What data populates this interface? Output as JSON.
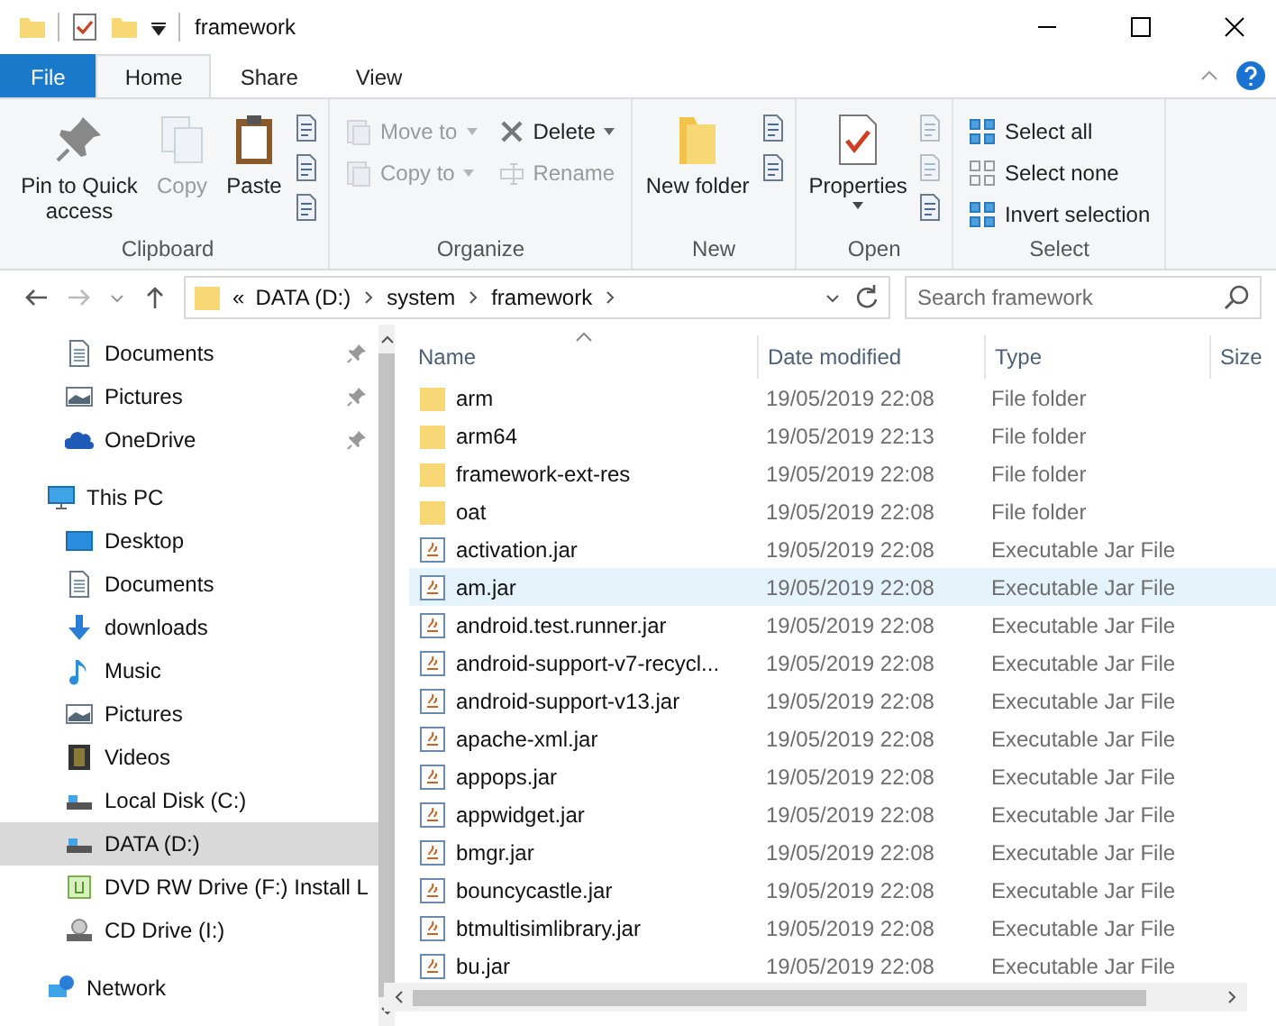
{
  "window": {
    "title": "framework"
  },
  "ribbon_tabs": [
    {
      "label": "File",
      "kind": "file",
      "selected": false
    },
    {
      "label": "Home",
      "kind": "tab",
      "selected": true
    },
    {
      "label": "Share",
      "kind": "tab",
      "selected": false
    },
    {
      "label": "View",
      "kind": "tab",
      "selected": false
    }
  ],
  "ribbon_groups": [
    {
      "label": "Clipboard",
      "columns": [
        [
          {
            "label": "Pin to Quick access",
            "kind": "large",
            "disabled": false,
            "dropdown": false
          }
        ],
        [
          {
            "label": "Copy",
            "kind": "large",
            "disabled": true,
            "dropdown": false
          }
        ],
        [
          {
            "label": "Paste",
            "kind": "large",
            "disabled": false,
            "dropdown": false
          }
        ],
        [
          {
            "kind": "icon",
            "disabled": false
          },
          {
            "kind": "icon",
            "disabled": false
          },
          {
            "kind": "icon",
            "disabled": false
          }
        ]
      ]
    },
    {
      "label": "Organize",
      "columns": [
        [
          {
            "label": "Move to",
            "kind": "small",
            "disabled": true,
            "dropdown": true
          },
          {
            "label": "Copy to",
            "kind": "small",
            "disabled": true,
            "dropdown": true
          }
        ],
        [
          {
            "label": "Delete",
            "kind": "small",
            "disabled": false,
            "dropdown": true
          },
          {
            "label": "Rename",
            "kind": "small",
            "disabled": true,
            "dropdown": false
          }
        ]
      ]
    },
    {
      "label": "New",
      "columns": [
        [
          {
            "label": "New folder",
            "kind": "large",
            "disabled": false,
            "dropdown": false
          }
        ],
        [
          {
            "kind": "icon",
            "disabled": false
          },
          {
            "kind": "icon",
            "disabled": false
          }
        ]
      ]
    },
    {
      "label": "Open",
      "columns": [
        [
          {
            "label": "Properties",
            "kind": "large",
            "disabled": false,
            "dropdown": true
          }
        ],
        [
          {
            "kind": "icon",
            "disabled": true
          },
          {
            "kind": "icon",
            "disabled": true
          },
          {
            "kind": "icon",
            "disabled": false
          }
        ]
      ]
    },
    {
      "label": "Select",
      "columns": [
        [
          {
            "label": "Select all",
            "kind": "small",
            "disabled": false,
            "dropdown": false
          },
          {
            "label": "Select none",
            "kind": "small",
            "disabled": false,
            "dropdown": false
          },
          {
            "label": "Invert selection",
            "kind": "small",
            "disabled": false,
            "dropdown": false
          }
        ]
      ]
    }
  ],
  "address": {
    "overflow": "«",
    "segments": [
      "DATA (D:)",
      "system",
      "framework"
    ]
  },
  "search": {
    "placeholder": "Search framework"
  },
  "nav": [
    {
      "label": "Documents",
      "pinned": true,
      "selected": false
    },
    {
      "label": "Pictures",
      "pinned": true,
      "selected": false
    },
    {
      "label": "OneDrive",
      "pinned": true,
      "selected": false
    },
    {
      "label": "This PC",
      "pinned": false,
      "selected": false,
      "children": [
        {
          "label": "Desktop",
          "pinned": false,
          "selected": false
        },
        {
          "label": "Documents",
          "pinned": false,
          "selected": false
        },
        {
          "label": "downloads",
          "pinned": false,
          "selected": false
        },
        {
          "label": "Music",
          "pinned": false,
          "selected": false
        },
        {
          "label": "Pictures",
          "pinned": false,
          "selected": false
        },
        {
          "label": "Videos",
          "pinned": false,
          "selected": false
        },
        {
          "label": "Local Disk (C:)",
          "pinned": false,
          "selected": false
        },
        {
          "label": "DATA (D:)",
          "pinned": false,
          "selected": true
        },
        {
          "label": "DVD RW Drive (F:) Install L",
          "pinned": false,
          "selected": false
        },
        {
          "label": "CD Drive (I:)",
          "pinned": false,
          "selected": false
        }
      ]
    },
    {
      "label": "Network",
      "pinned": false,
      "selected": false
    }
  ],
  "table": {
    "columns": [
      {
        "label": "Name",
        "sorted": true
      },
      {
        "label": "Date modified",
        "sorted": false
      },
      {
        "label": "Type",
        "sorted": false
      },
      {
        "label": "Size",
        "sorted": false
      }
    ],
    "rows": [
      {
        "kind": "folder",
        "name": "arm",
        "date": "19/05/2019 22:08",
        "type": "File folder",
        "selected": false
      },
      {
        "kind": "folder",
        "name": "arm64",
        "date": "19/05/2019 22:13",
        "type": "File folder",
        "selected": false
      },
      {
        "kind": "folder",
        "name": "framework-ext-res",
        "date": "19/05/2019 22:08",
        "type": "File folder",
        "selected": false
      },
      {
        "kind": "folder",
        "name": "oat",
        "date": "19/05/2019 22:08",
        "type": "File folder",
        "selected": false
      },
      {
        "kind": "jar",
        "name": "activation.jar",
        "date": "19/05/2019 22:08",
        "type": "Executable Jar File",
        "selected": false
      },
      {
        "kind": "jar",
        "name": "am.jar",
        "date": "19/05/2019 22:08",
        "type": "Executable Jar File",
        "selected": true
      },
      {
        "kind": "jar",
        "name": "android.test.runner.jar",
        "date": "19/05/2019 22:08",
        "type": "Executable Jar File",
        "selected": false
      },
      {
        "kind": "jar",
        "name": "android-support-v7-recycl...",
        "date": "19/05/2019 22:08",
        "type": "Executable Jar File",
        "selected": false
      },
      {
        "kind": "jar",
        "name": "android-support-v13.jar",
        "date": "19/05/2019 22:08",
        "type": "Executable Jar File",
        "selected": false
      },
      {
        "kind": "jar",
        "name": "apache-xml.jar",
        "date": "19/05/2019 22:08",
        "type": "Executable Jar File",
        "selected": false
      },
      {
        "kind": "jar",
        "name": "appops.jar",
        "date": "19/05/2019 22:08",
        "type": "Executable Jar File",
        "selected": false
      },
      {
        "kind": "jar",
        "name": "appwidget.jar",
        "date": "19/05/2019 22:08",
        "type": "Executable Jar File",
        "selected": false
      },
      {
        "kind": "jar",
        "name": "bmgr.jar",
        "date": "19/05/2019 22:08",
        "type": "Executable Jar File",
        "selected": false
      },
      {
        "kind": "jar",
        "name": "bouncycastle.jar",
        "date": "19/05/2019 22:08",
        "type": "Executable Jar File",
        "selected": false
      },
      {
        "kind": "jar",
        "name": "btmultisimlibrary.jar",
        "date": "19/05/2019 22:08",
        "type": "Executable Jar File",
        "selected": false
      },
      {
        "kind": "jar",
        "name": "bu.jar",
        "date": "19/05/2019 22:08",
        "type": "Executable Jar File",
        "selected": false
      }
    ]
  }
}
